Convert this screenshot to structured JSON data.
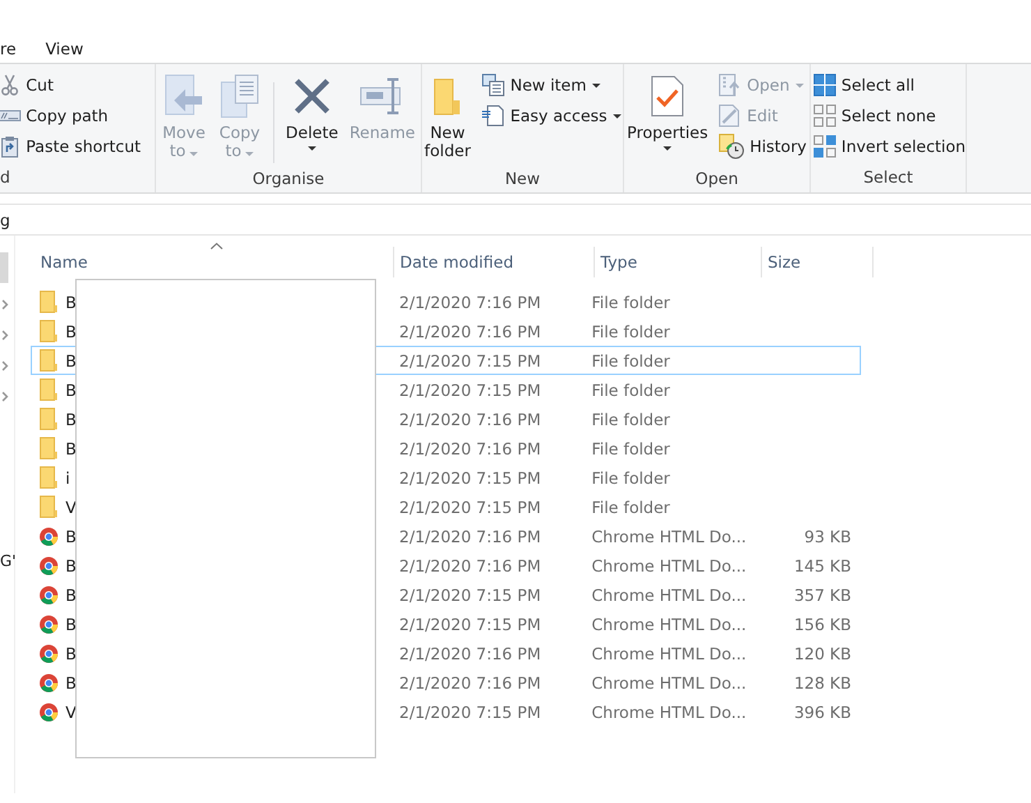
{
  "tabs": [
    {
      "label": "re",
      "selected": false
    },
    {
      "label": "View",
      "selected": false
    }
  ],
  "ribbon": {
    "groups": [
      {
        "label": "d",
        "items": [
          {
            "kind": "small",
            "label": "Cut",
            "disabled": false,
            "dropdown": false
          },
          {
            "kind": "small",
            "label": "Copy path",
            "disabled": false,
            "dropdown": false
          },
          {
            "kind": "small",
            "label": "Paste shortcut",
            "disabled": false,
            "dropdown": false
          }
        ]
      },
      {
        "label": "Organise",
        "items": [
          {
            "kind": "large",
            "lines": [
              "Move",
              "to"
            ],
            "disabled": true,
            "dropdown": true
          },
          {
            "kind": "large",
            "lines": [
              "Copy",
              "to"
            ],
            "disabled": true,
            "dropdown": true
          },
          {
            "kind": "separator"
          },
          {
            "kind": "large",
            "lines": [
              "Delete"
            ],
            "disabled": false,
            "dropdown": true
          },
          {
            "kind": "large",
            "lines": [
              "Rename"
            ],
            "disabled": true,
            "dropdown": false
          }
        ]
      },
      {
        "label": "New",
        "items": [
          {
            "kind": "large",
            "lines": [
              "New",
              "folder"
            ],
            "disabled": false,
            "dropdown": false
          },
          {
            "kind": "small",
            "label": "New item",
            "disabled": false,
            "dropdown": true
          },
          {
            "kind": "small",
            "label": "Easy access",
            "disabled": false,
            "dropdown": true
          }
        ]
      },
      {
        "label": "Open",
        "items": [
          {
            "kind": "large",
            "lines": [
              "Properties"
            ],
            "disabled": false,
            "dropdown": true
          },
          {
            "kind": "small",
            "label": "Open",
            "disabled": true,
            "dropdown": true
          },
          {
            "kind": "small",
            "label": "Edit",
            "disabled": true,
            "dropdown": false
          },
          {
            "kind": "small",
            "label": "History",
            "disabled": false,
            "dropdown": false
          }
        ]
      },
      {
        "label": "Select",
        "items": [
          {
            "kind": "small",
            "label": "Select all",
            "disabled": false,
            "dropdown": false
          },
          {
            "kind": "small",
            "label": "Select none",
            "disabled": false,
            "dropdown": false
          },
          {
            "kind": "small",
            "label": "Invert selection",
            "disabled": false,
            "dropdown": false
          }
        ]
      }
    ]
  },
  "address": "g",
  "nav": {
    "label": "G'"
  },
  "table": {
    "columns": [
      "Name",
      "Date modified",
      "Type",
      "Size"
    ],
    "rows": [
      {
        "kind": "folder",
        "name": "B",
        "date": "2/1/2020 7:16 PM",
        "type": "File folder",
        "focused": false
      },
      {
        "kind": "folder",
        "name": "B",
        "date": "2/1/2020 7:16 PM",
        "type": "File folder",
        "focused": false
      },
      {
        "kind": "folder",
        "name": "B",
        "date": "2/1/2020 7:15 PM",
        "type": "File folder",
        "focused": true
      },
      {
        "kind": "folder",
        "name": "B",
        "date": "2/1/2020 7:15 PM",
        "type": "File folder",
        "focused": false
      },
      {
        "kind": "folder",
        "name": "B",
        "date": "2/1/2020 7:16 PM",
        "type": "File folder",
        "focused": false
      },
      {
        "kind": "folder",
        "name": "B",
        "date": "2/1/2020 7:16 PM",
        "type": "File folder",
        "focused": false
      },
      {
        "kind": "folder",
        "name": "i",
        "date": "2/1/2020 7:15 PM",
        "type": "File folder",
        "focused": false
      },
      {
        "kind": "folder",
        "name": "V",
        "date": "2/1/2020 7:15 PM",
        "type": "File folder",
        "focused": false
      },
      {
        "kind": "document",
        "name": "B",
        "date": "2/1/2020 7:16 PM",
        "type": "Chrome HTML Do...",
        "size": "93 KB",
        "focused": false
      },
      {
        "kind": "document",
        "name": "B",
        "date": "2/1/2020 7:16 PM",
        "type": "Chrome HTML Do...",
        "size": "145 KB",
        "focused": false
      },
      {
        "kind": "document",
        "name": "B",
        "date": "2/1/2020 7:15 PM",
        "type": "Chrome HTML Do...",
        "size": "357 KB",
        "focused": false
      },
      {
        "kind": "document",
        "name": "B",
        "date": "2/1/2020 7:15 PM",
        "type": "Chrome HTML Do...",
        "size": "156 KB",
        "focused": false
      },
      {
        "kind": "document",
        "name": "B",
        "date": "2/1/2020 7:16 PM",
        "type": "Chrome HTML Do...",
        "size": "120 KB",
        "focused": false
      },
      {
        "kind": "document",
        "name": "B",
        "date": "2/1/2020 7:16 PM",
        "type": "Chrome HTML Do...",
        "size": "128 KB",
        "focused": false
      },
      {
        "kind": "document",
        "name": "V",
        "date": "2/1/2020 7:15 PM",
        "type": "Chrome HTML Do...",
        "size": "396 KB",
        "focused": false
      }
    ]
  }
}
